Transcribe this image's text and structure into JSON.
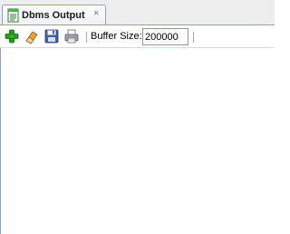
{
  "tab": {
    "icon": "document-output-icon",
    "label": "Dbms Output",
    "close_glyph": "×"
  },
  "toolbar": {
    "buttons": [
      {
        "name": "enable-output-button",
        "icon": "green-plus-icon"
      },
      {
        "name": "clear-button",
        "icon": "eraser-icon"
      },
      {
        "name": "save-button",
        "icon": "floppy-disk-icon"
      },
      {
        "name": "print-button",
        "icon": "printer-icon"
      }
    ],
    "buffer_label": "Buffer Size:",
    "buffer_value": "200000"
  },
  "colors": {
    "tab_border": "#8da0bf",
    "plus_green": "#1f9d1f",
    "panel_bg": "#eeeeee"
  }
}
